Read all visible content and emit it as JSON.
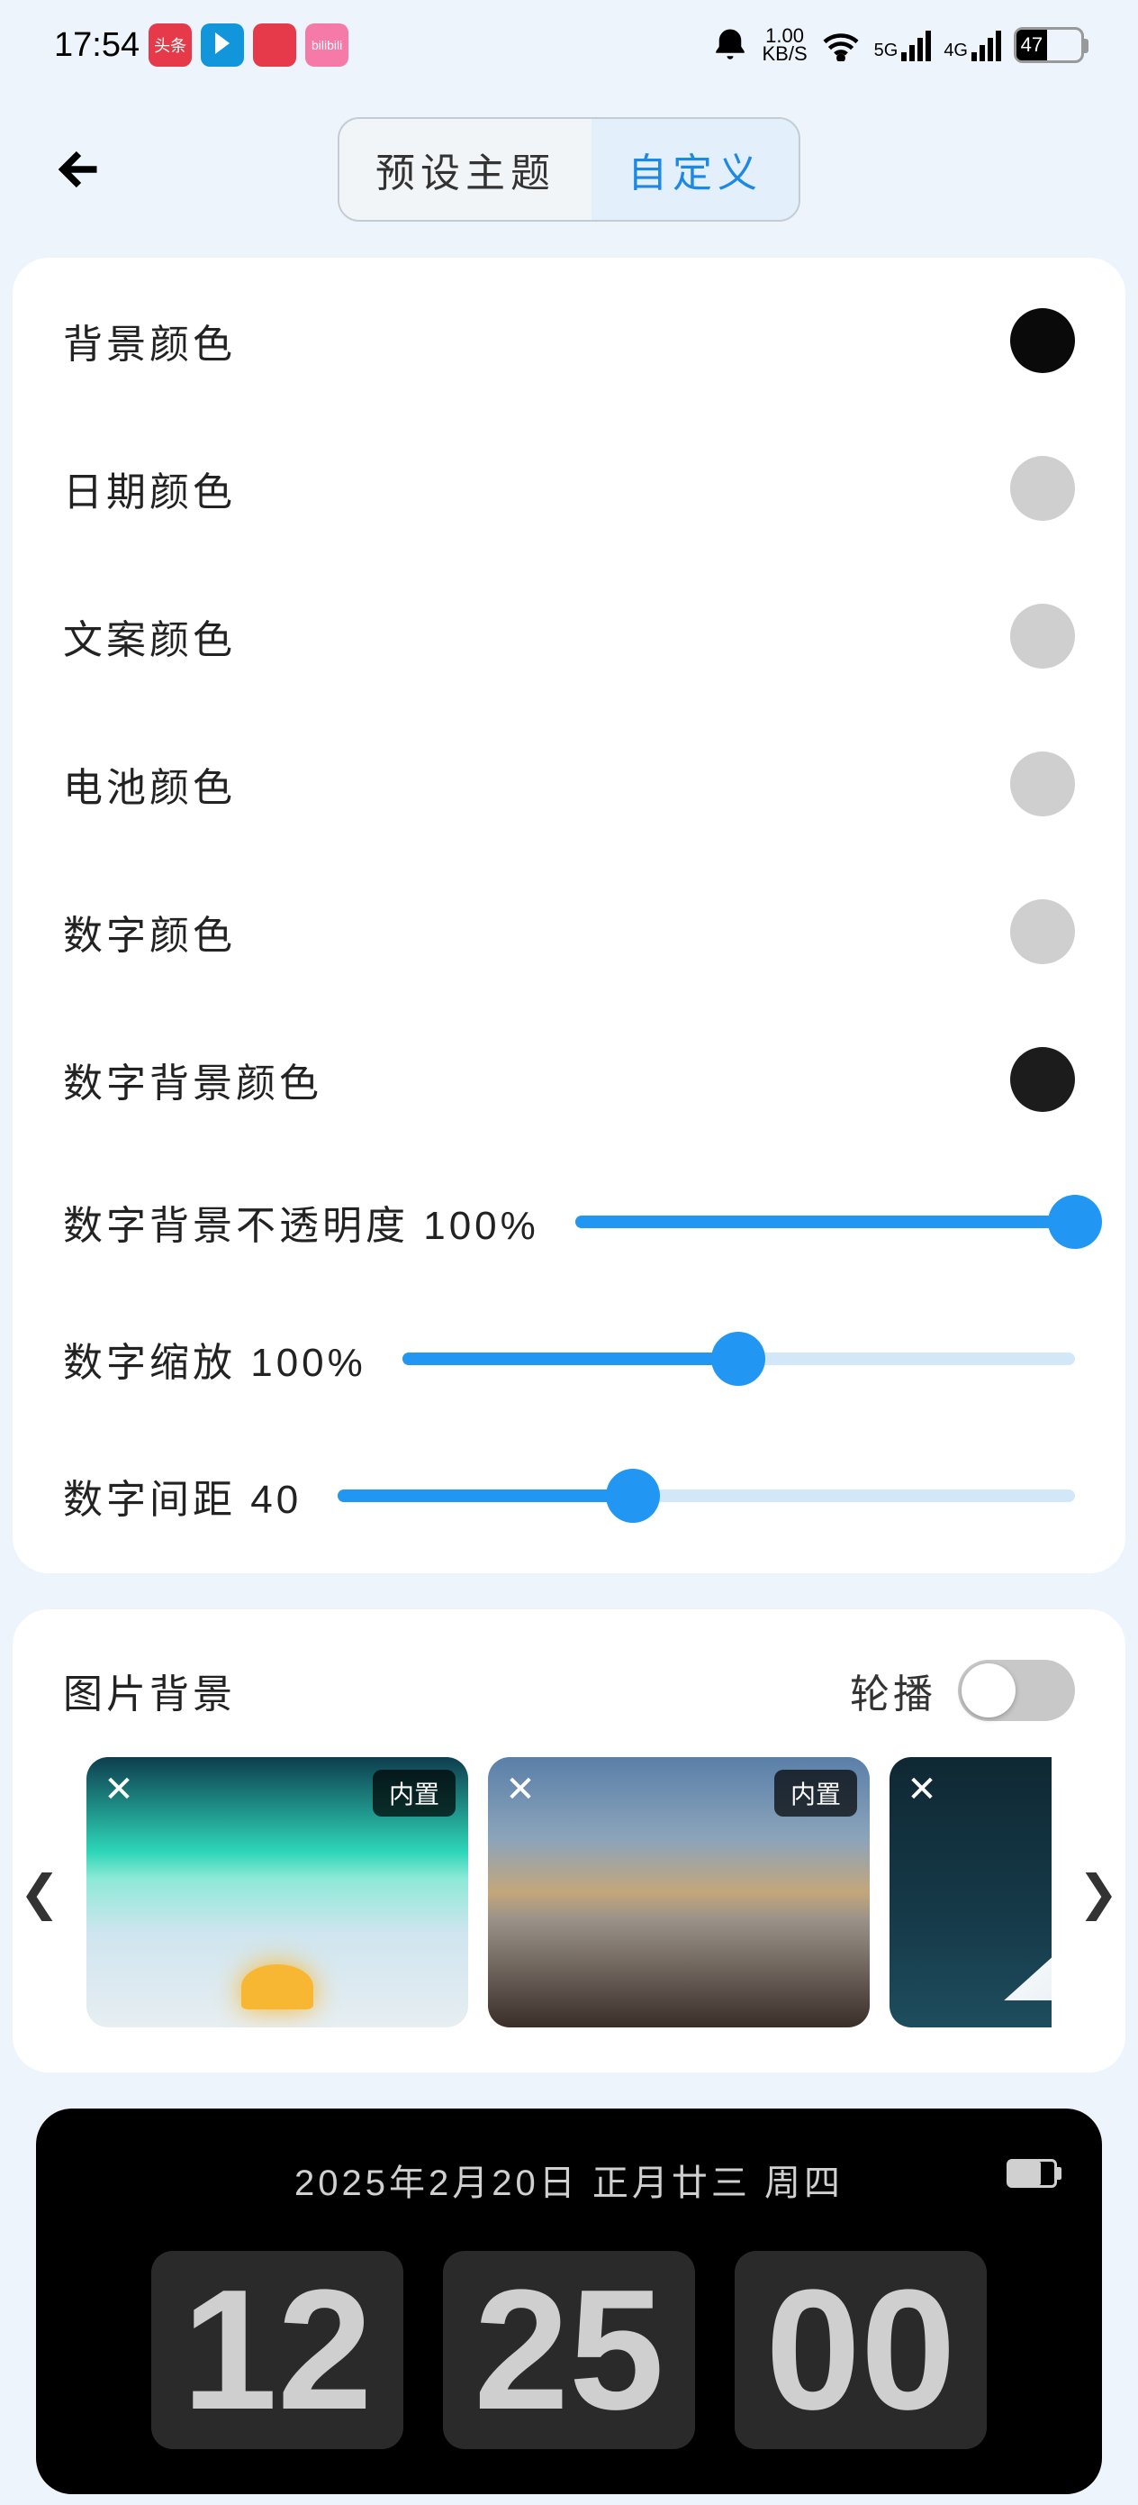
{
  "status": {
    "time": "17:54",
    "speed_top": "1.00",
    "speed_bottom": "KB/S",
    "net1": "5G",
    "net2": "4G",
    "battery_pct": "47",
    "battery_width": "47%"
  },
  "tabs": {
    "preset": "预设主题",
    "custom": "自定义"
  },
  "colors": {
    "bg": "背景颜色",
    "date": "日期颜色",
    "text": "文案颜色",
    "battery": "电池颜色",
    "digit": "数字颜色",
    "digit_bg": "数字背景颜色"
  },
  "sliders": {
    "opacity": {
      "label": "数字背景不透明度 100%",
      "pct": 100
    },
    "scale": {
      "label": "数字缩放 100%",
      "pct": 50
    },
    "spacing": {
      "label": "数字间距 40",
      "pct": 40
    }
  },
  "images": {
    "title": "图片背景",
    "carousel": "轮播",
    "builtin": "内置",
    "builtin2": "内"
  },
  "preview": {
    "date": "2025年2月20日 正月廿三 周四",
    "d1": "12",
    "d2": "25",
    "d3": "00"
  }
}
